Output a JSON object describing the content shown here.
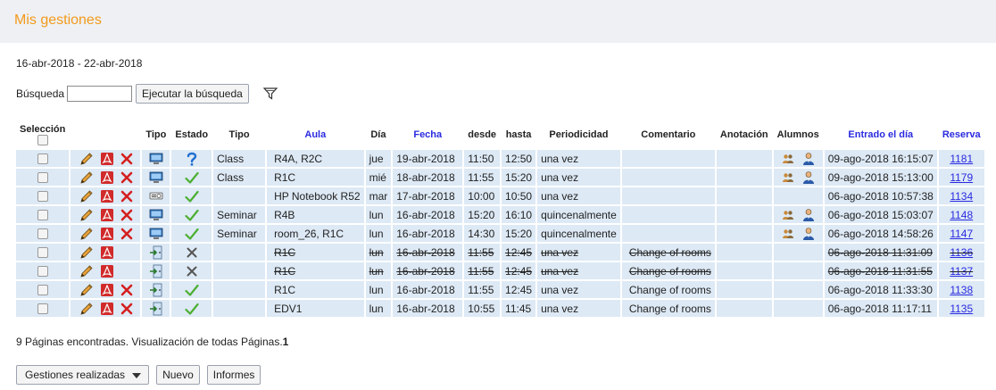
{
  "header": {
    "title": "Mis gestiones"
  },
  "date_range": "16-abr-2018 - 22-abr-2018",
  "search": {
    "label": "Búsqueda",
    "value": "",
    "button": "Ejecutar la búsqueda",
    "filter_icon": "filter-icon"
  },
  "columns": {
    "seleccion": "Selección",
    "tipo_icon": "Tipo",
    "estado": "Estado",
    "tipo": "Tipo",
    "aula": "Aula",
    "dia": "Día",
    "fecha": "Fecha",
    "desde": "desde",
    "hasta": "hasta",
    "periodicidad": "Periodicidad",
    "comentario": "Comentario",
    "anotacion": "Anotación",
    "alumnos": "Alumnos",
    "entrado": "Entrado el día",
    "reserva": "Reserva"
  },
  "rows": [
    {
      "struck": false,
      "delete": true,
      "type_icon": "monitor-icon",
      "status": "question",
      "tipo": "Class",
      "aula": "R4A, R2C",
      "dia": "jue",
      "fecha": "19-abr-2018",
      "desde": "11:50",
      "hasta": "12:50",
      "periodicidad": "una vez",
      "comentario": "",
      "anotacion": "",
      "students": true,
      "entrado": "09-ago-2018 16:15:07",
      "reserva": "1181"
    },
    {
      "struck": false,
      "delete": true,
      "type_icon": "monitor-icon",
      "status": "check",
      "tipo": "Class",
      "aula": "R1C",
      "dia": "mié",
      "fecha": "18-abr-2018",
      "desde": "11:55",
      "hasta": "15:20",
      "periodicidad": "una vez",
      "comentario": "",
      "anotacion": "",
      "students": true,
      "entrado": "09-ago-2018 15:13:00",
      "reserva": "1179"
    },
    {
      "struck": false,
      "delete": true,
      "type_icon": "projector-icon",
      "status": "check",
      "tipo": "",
      "aula": "HP Notebook R52",
      "dia": "mar",
      "fecha": "17-abr-2018",
      "desde": "10:00",
      "hasta": "10:50",
      "periodicidad": "una vez",
      "comentario": "",
      "anotacion": "",
      "students": false,
      "entrado": "06-ago-2018 10:57:38",
      "reserva": "1134"
    },
    {
      "struck": false,
      "delete": true,
      "type_icon": "monitor-icon",
      "status": "check",
      "tipo": "Seminar",
      "aula": "R4B",
      "dia": "lun",
      "fecha": "16-abr-2018",
      "desde": "15:20",
      "hasta": "16:10",
      "periodicidad": "quincenalmente",
      "comentario": "",
      "anotacion": "",
      "students": true,
      "entrado": "06-ago-2018 15:03:07",
      "reserva": "1148"
    },
    {
      "struck": false,
      "delete": true,
      "type_icon": "monitor-icon",
      "status": "check",
      "tipo": "Seminar",
      "aula": "room_26, R1C",
      "dia": "lun",
      "fecha": "16-abr-2018",
      "desde": "14:30",
      "hasta": "15:20",
      "periodicidad": "quincenalmente",
      "comentario": "",
      "anotacion": "",
      "students": true,
      "entrado": "06-ago-2018 14:58:26",
      "reserva": "1147"
    },
    {
      "struck": true,
      "delete": false,
      "type_icon": "door-icon",
      "status": "cross",
      "tipo": "",
      "aula": "R1C",
      "dia": "lun",
      "fecha": "16-abr-2018",
      "desde": "11:55",
      "hasta": "12:45",
      "periodicidad": "una vez",
      "comentario": "Change of rooms",
      "anotacion": "",
      "students": false,
      "entrado": "06-ago-2018 11:31:09",
      "reserva": "1136"
    },
    {
      "struck": true,
      "delete": false,
      "type_icon": "door-icon",
      "status": "cross",
      "tipo": "",
      "aula": "R1C",
      "dia": "lun",
      "fecha": "16-abr-2018",
      "desde": "11:55",
      "hasta": "12:45",
      "periodicidad": "una vez",
      "comentario": "Change of rooms",
      "anotacion": "",
      "students": false,
      "entrado": "06-ago-2018 11:31:55",
      "reserva": "1137"
    },
    {
      "struck": false,
      "delete": true,
      "type_icon": "door-icon",
      "status": "check",
      "tipo": "",
      "aula": "R1C",
      "dia": "lun",
      "fecha": "16-abr-2018",
      "desde": "11:55",
      "hasta": "12:45",
      "periodicidad": "una vez",
      "comentario": "Change of rooms",
      "anotacion": "",
      "students": false,
      "entrado": "06-ago-2018 11:33:30",
      "reserva": "1138"
    },
    {
      "struck": false,
      "delete": true,
      "type_icon": "door-icon",
      "status": "check",
      "tipo": "",
      "aula": "EDV1",
      "dia": "lun",
      "fecha": "16-abr-2018",
      "desde": "10:55",
      "hasta": "11:45",
      "periodicidad": "una vez",
      "comentario": "Change of rooms",
      "anotacion": "",
      "students": false,
      "entrado": "06-ago-2018 11:17:11",
      "reserva": "1135"
    }
  ],
  "footer": {
    "pages_text": "9 Páginas encontradas. Visualización de todas Páginas.",
    "pages_bold": "1"
  },
  "buttons": {
    "dropdown": "Gestiones realizadas",
    "new": "Nuevo",
    "reports": "Informes"
  }
}
